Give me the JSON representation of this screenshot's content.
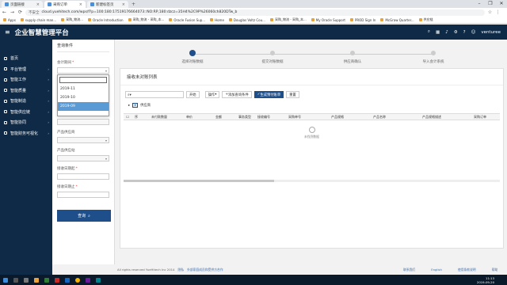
{
  "browser": {
    "tabs": [
      {
        "label": "页面链接",
        "active": false
      },
      {
        "label": "采购订单",
        "active": true
      },
      {
        "label": "新建标签页",
        "active": false
      }
    ],
    "new_tab": "+",
    "window_controls": [
      "–",
      "❐",
      "✕"
    ],
    "security_label": "不安全",
    "url": "cloud.yuehitech.com/wps/f?p=100:180:17519176664073::NO:RP,180:dzcz=35H4%2C9P%26060ch820DTw_b",
    "bookmarks": [
      "Apps",
      "supply chain man...",
      "采购_物流...",
      "Oracle Introduction",
      "采购_物流 - 采购_本...",
      "Oracle Fusion Sup...",
      "Home",
      "Douglas Voltz Cou...",
      "采购_物流 - 采购_本...",
      "My Oracle Support",
      "PROD Sign In",
      "McGraw Quarter...",
      "供应链"
    ]
  },
  "app": {
    "menu_icon": "≡",
    "title": "企业智慧管理平台",
    "header_icons": [
      "search-icon",
      "grid-icon",
      "bell-icon",
      "settings-icon",
      "help-icon",
      "user-icon"
    ],
    "user_label": "venturee"
  },
  "sidebar": {
    "items": [
      {
        "label": "首页"
      },
      {
        "label": "平台管理"
      },
      {
        "label": "智能工作"
      },
      {
        "label": "智能质量"
      },
      {
        "label": "智能制造"
      },
      {
        "label": "智能供应链"
      },
      {
        "label": "智能协同"
      },
      {
        "label": "智能财务可视化"
      }
    ]
  },
  "query_panel": {
    "title": "查询条件",
    "fields": [
      {
        "label": "会计期间",
        "required": true
      },
      {
        "label": "订单交货期",
        "required": false
      },
      {
        "label": "产品供应商",
        "required": false
      },
      {
        "label": "产品供应站",
        "required": false
      },
      {
        "label": "接收日期起",
        "required": true
      },
      {
        "label": "接收日期止",
        "required": true
      }
    ],
    "period_options": [
      "2019-11",
      "2019-10",
      "2019-09"
    ],
    "selected_period": "2019-09",
    "query_button": "查询"
  },
  "steps": [
    {
      "label": "选择对账数据",
      "active": true
    },
    {
      "label": "提交对账数据",
      "active": false
    },
    {
      "label": "供应商确认",
      "active": false
    },
    {
      "label": "导入会计系统",
      "active": false
    }
  ],
  "main": {
    "card_title": "接收未对账列表",
    "toolbar": {
      "search_placeholder": "",
      "go_label": "开始",
      "actions_label": "操作",
      "buttons": [
        "添加查询条件",
        "生成预付账单",
        "重置"
      ]
    },
    "tree_label": "供应商",
    "columns": [
      "",
      "序",
      "未付款数量",
      "单价",
      "金额",
      "事务类型",
      "接收编号",
      "采购单号",
      "产品规格",
      "产品名称",
      "产品规格描述",
      "采购订单"
    ],
    "empty_text": "未找到数据"
  },
  "footer": {
    "copyright": "All rights reserved YueHitech Inc 2014",
    "links_left": [
      "隐私",
      "外部家庭成员和受供方合作"
    ],
    "links_right": [
      "联系我们",
      "English",
      "使用条款说明",
      "帮助"
    ]
  },
  "taskbar": {
    "time": "11:13",
    "date": "2019-09-20"
  }
}
